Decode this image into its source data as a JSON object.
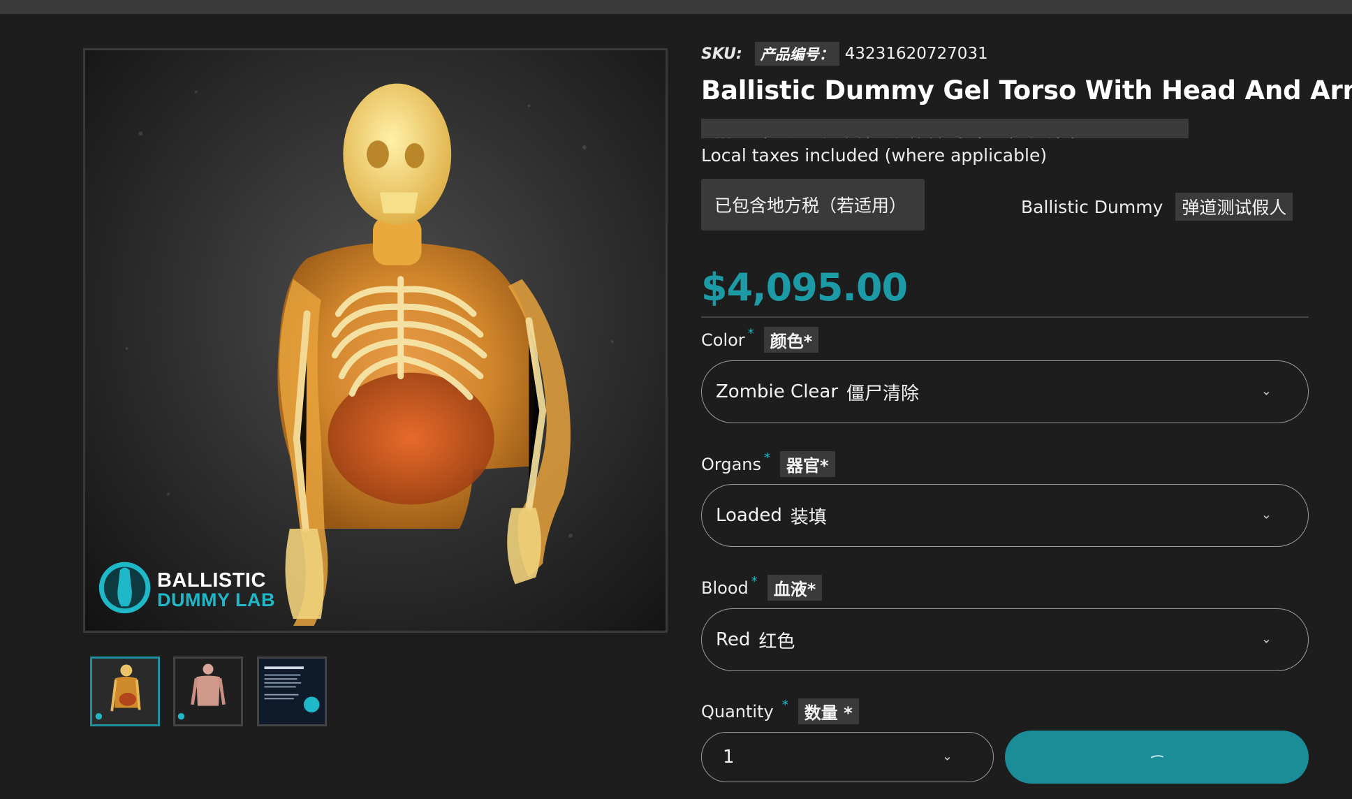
{
  "sku": {
    "label": "SKU:",
    "translation": "产品编号：",
    "value": "43231620727031"
  },
  "product": {
    "title": "Ballistic Dummy Gel Torso With Head And Arms",
    "title_translation": "带头部和手臂的弹道仿真凝胶人体躯干"
  },
  "tax": {
    "text": "Local taxes included (where applicable)",
    "translation": "已包含地方税（若适用）"
  },
  "vendor": {
    "name": "Ballistic Dummy",
    "translation": "弹道测试假人"
  },
  "price": "$4,095.00",
  "brand": {
    "line1": "BALLISTIC",
    "line2": "DUMMY LAB"
  },
  "options": {
    "color": {
      "label": "Color",
      "required": "*",
      "translation": "颜色*",
      "value": "Zombie Clear",
      "value_translation": "僵尸清除"
    },
    "organs": {
      "label": "Organs",
      "required": "*",
      "translation": "器官*",
      "value": "Loaded",
      "value_translation": "装填"
    },
    "blood": {
      "label": "Blood",
      "required": "*",
      "translation": "血液*",
      "value": "Red",
      "value_translation": "红色"
    }
  },
  "quantity": {
    "label": "Quantity",
    "required": "*",
    "translation": "数量 *",
    "value": "1"
  },
  "colors": {
    "accent": "#1c9aa6",
    "button": "#1a8d98",
    "background": "#1d1d1d",
    "chip": "#3a3a3a"
  },
  "icons": {
    "select": "chevron-down-icon",
    "button": "loading-spinner-icon"
  }
}
